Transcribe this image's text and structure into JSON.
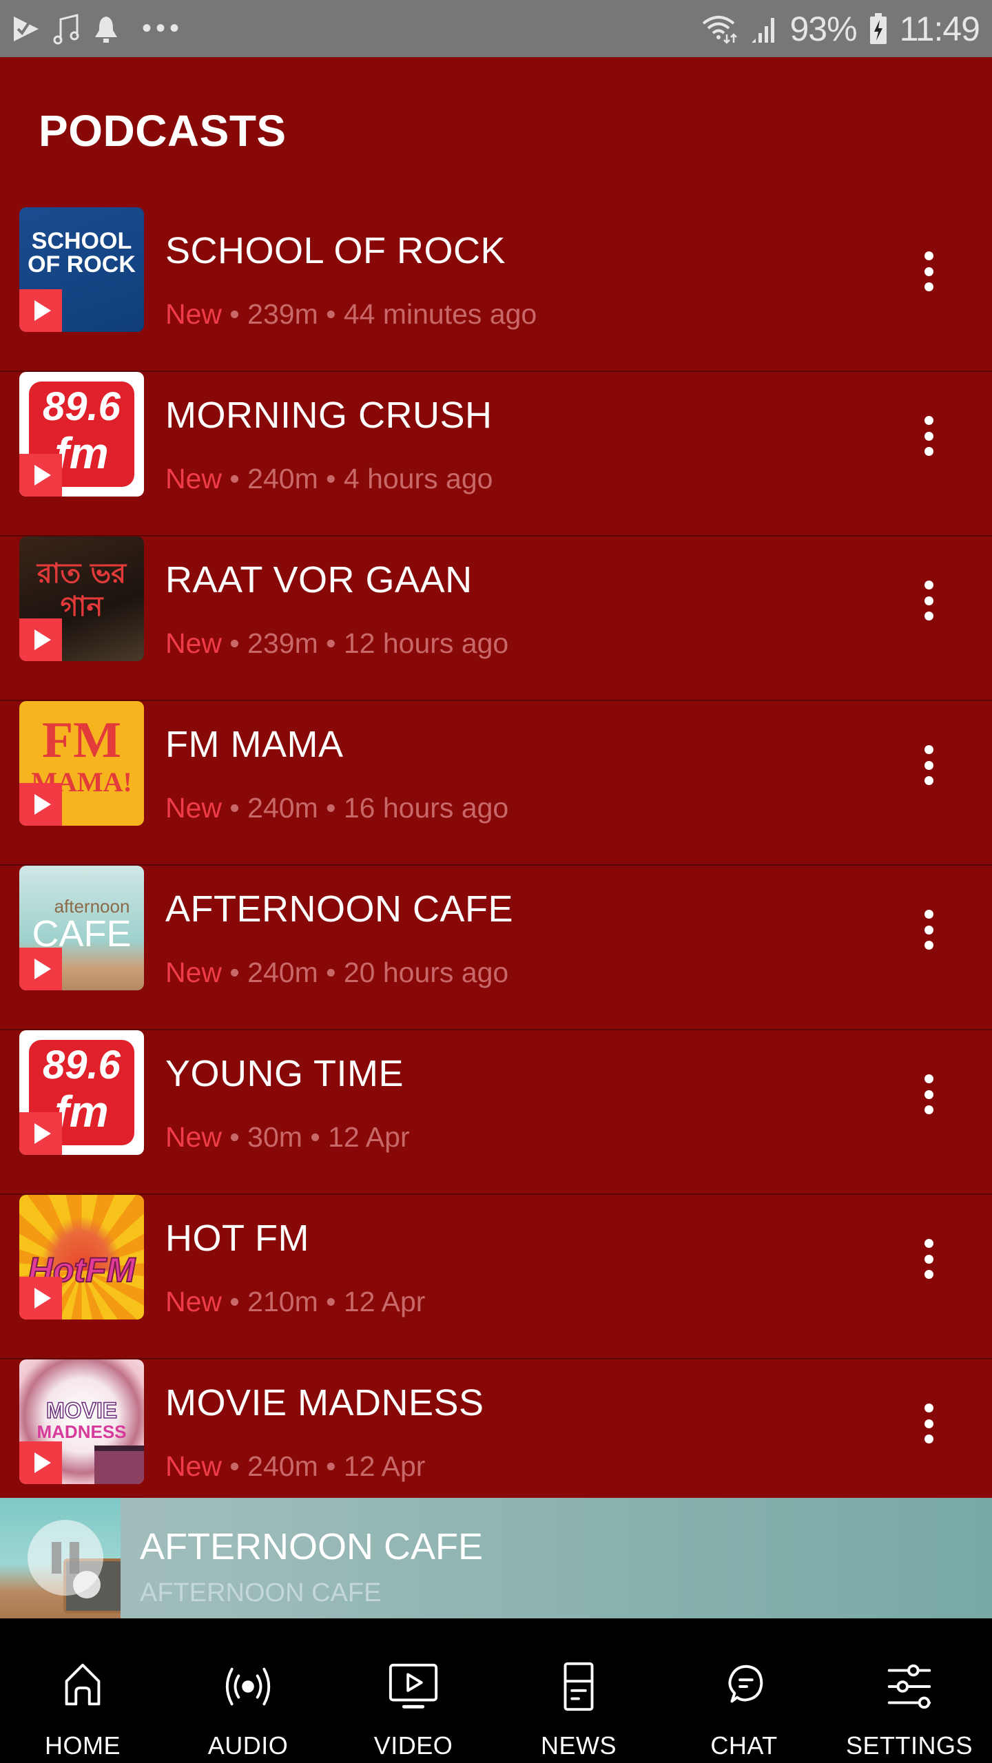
{
  "status_bar": {
    "left_icons": [
      "play-store-check-icon",
      "music-note-icon",
      "bell-icon",
      "more-dots-icon"
    ],
    "right_icons": [
      "wifi-icon",
      "signal-icon",
      "battery-charging-icon"
    ],
    "battery": "93%",
    "time": "11:49"
  },
  "page": {
    "title": "PODCASTS"
  },
  "podcasts": [
    {
      "title": "SCHOOL OF ROCK",
      "badge": "New",
      "duration": "239m",
      "when": "44 minutes ago",
      "art": "school-of-rock-art"
    },
    {
      "title": "MORNING CRUSH",
      "badge": "New",
      "duration": "240m",
      "when": "4 hours ago",
      "art": "89-6-fm-logo"
    },
    {
      "title": "RAAT VOR GAAN",
      "badge": "New",
      "duration": "239m",
      "when": "12 hours ago",
      "art": "raat-vor-gaan-art"
    },
    {
      "title": "FM MAMA",
      "badge": "New",
      "duration": "240m",
      "when": "16 hours ago",
      "art": "fm-mama-art"
    },
    {
      "title": "AFTERNOON CAFE",
      "badge": "New",
      "duration": "240m",
      "when": "20 hours ago",
      "art": "afternoon-cafe-art"
    },
    {
      "title": "YOUNG TIME",
      "badge": "New",
      "duration": "30m",
      "when": "12 Apr",
      "art": "89-6-fm-logo"
    },
    {
      "title": "HOT FM",
      "badge": "New",
      "duration": "210m",
      "when": "12 Apr",
      "art": "hot-fm-art"
    },
    {
      "title": "MOVIE MADNESS",
      "badge": "New",
      "duration": "240m",
      "when": "12 Apr",
      "art": "movie-madness-art"
    }
  ],
  "art_text": {
    "school_of_rock": "SCHOOL OF ROCK",
    "fm_logo_top": "89.6",
    "fm_logo_bottom": "fm",
    "raat_vor_gaan": "রাত ভর গান",
    "fm_mama_top": "FM",
    "fm_mama_bottom": "MAMA!",
    "afternoon_cafe_top": "afternoon",
    "afternoon_cafe_bottom": "CAFE",
    "hot_fm": "HotFM",
    "movie_madness_top": "MOVIE",
    "movie_madness_bottom": "MADNESS"
  },
  "separator": " • ",
  "mini_player": {
    "title": "AFTERNOON CAFE",
    "subtitle": "AFTERNOON CAFE",
    "state": "playing"
  },
  "bottom_nav": [
    {
      "label": "HOME",
      "icon": "home-icon"
    },
    {
      "label": "AUDIO",
      "icon": "broadcast-icon"
    },
    {
      "label": "VIDEO",
      "icon": "video-screen-icon"
    },
    {
      "label": "NEWS",
      "icon": "news-icon"
    },
    {
      "label": "CHAT",
      "icon": "chat-bubble-icon"
    },
    {
      "label": "SETTINGS",
      "icon": "sliders-icon"
    }
  ],
  "colors": {
    "background": "#880808",
    "status_bar": "#777777",
    "new_badge": "#f03c46",
    "meta_text": "#c86868",
    "play_badge": "#f23a45",
    "nav_background": "#000000"
  }
}
